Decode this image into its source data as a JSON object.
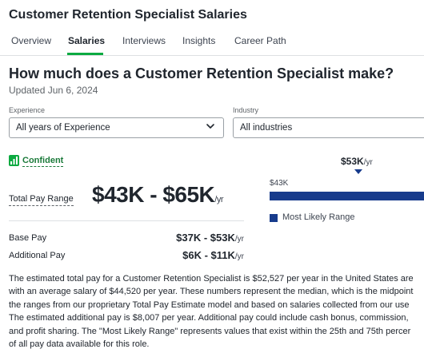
{
  "header": {
    "title": "Customer Retention Specialist Salaries",
    "tabs": [
      {
        "label": "Overview"
      },
      {
        "label": "Salaries"
      },
      {
        "label": "Interviews"
      },
      {
        "label": "Insights"
      },
      {
        "label": "Career Path"
      }
    ],
    "active_tab": "Salaries"
  },
  "main": {
    "heading": "How much does a Customer Retention Specialist make?",
    "updated": "Updated Jun 6, 2024",
    "filters": {
      "experience_label": "Experience",
      "experience_value": "All years of Experience",
      "industry_label": "Industry",
      "industry_value": "All industries"
    },
    "confidence": "Confident",
    "total_pay": {
      "label": "Total Pay Range",
      "value": "$43K - $65K",
      "unit": "/yr"
    },
    "base_pay": {
      "label": "Base Pay",
      "value": "$37K - $53K",
      "unit": "/yr"
    },
    "additional_pay": {
      "label": "Additional Pay",
      "value": "$6K - $11K",
      "unit": "/yr"
    },
    "range_chart": {
      "most_likely_value": "$53K",
      "unit": "/yr",
      "min_label": "$43K",
      "legend": "Most Likely Range"
    },
    "description_lines": [
      "The estimated total pay for a Customer Retention Specialist is $52,527 per year in the United States are",
      "with an average salary of $44,520 per year. These numbers represent the median, which is the midpoint",
      "the ranges from our proprietary Total Pay Estimate model and based on salaries collected from our use",
      "The estimated additional pay is $8,007 per year. Additional pay could include cash bonus, commission,",
      "and profit sharing. The \"Most Likely Range\" represents values that exist within the 25th and 75th percer",
      "of all pay data available for this role."
    ]
  },
  "colors": {
    "accent_green": "#0caa41",
    "range_blue": "#173b8c",
    "text": "#20262e"
  },
  "icons": {
    "confidence": "signal-bars-icon",
    "select": "chevron-down-icon"
  }
}
